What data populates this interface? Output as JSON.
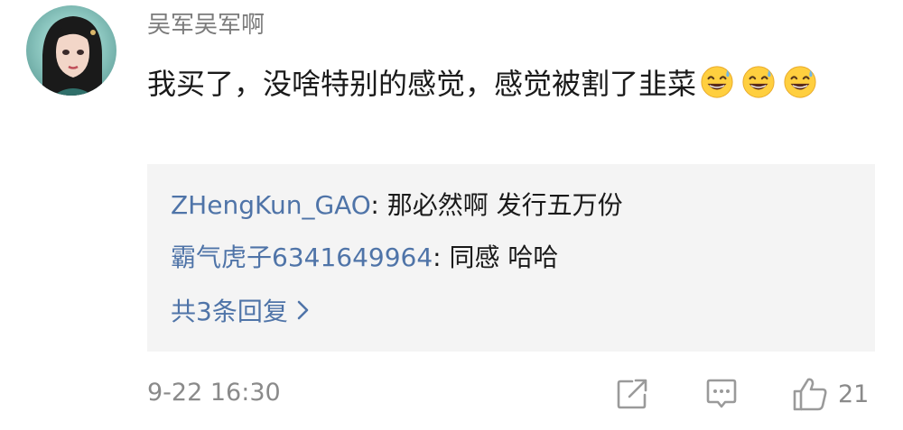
{
  "comment": {
    "username": "吴军吴军啊",
    "text": "我买了，没啥特别的感觉，感觉被割了韭菜",
    "emoji_icon": "grinning-sweat-emoji",
    "emoji_count": 3,
    "timestamp": "9-22 16:30",
    "like_count": "21"
  },
  "replies": {
    "items": [
      {
        "user": "ZHengKun_GAO",
        "separator": ": ",
        "text": "那必然啊 发行五万份"
      },
      {
        "user": "霸气虎子6341649964",
        "separator": ": ",
        "text": "同感  哈哈"
      }
    ],
    "more_label": "共3条回复"
  },
  "colors": {
    "link": "#4f74a8",
    "meta_gray": "#8a8a8a",
    "reply_bg": "#f4f4f4",
    "icon_gray": "#9a9a9a"
  },
  "icons": [
    "share-icon",
    "reply-comment-icon",
    "thumbs-up-icon",
    "chevron-right-icon"
  ]
}
